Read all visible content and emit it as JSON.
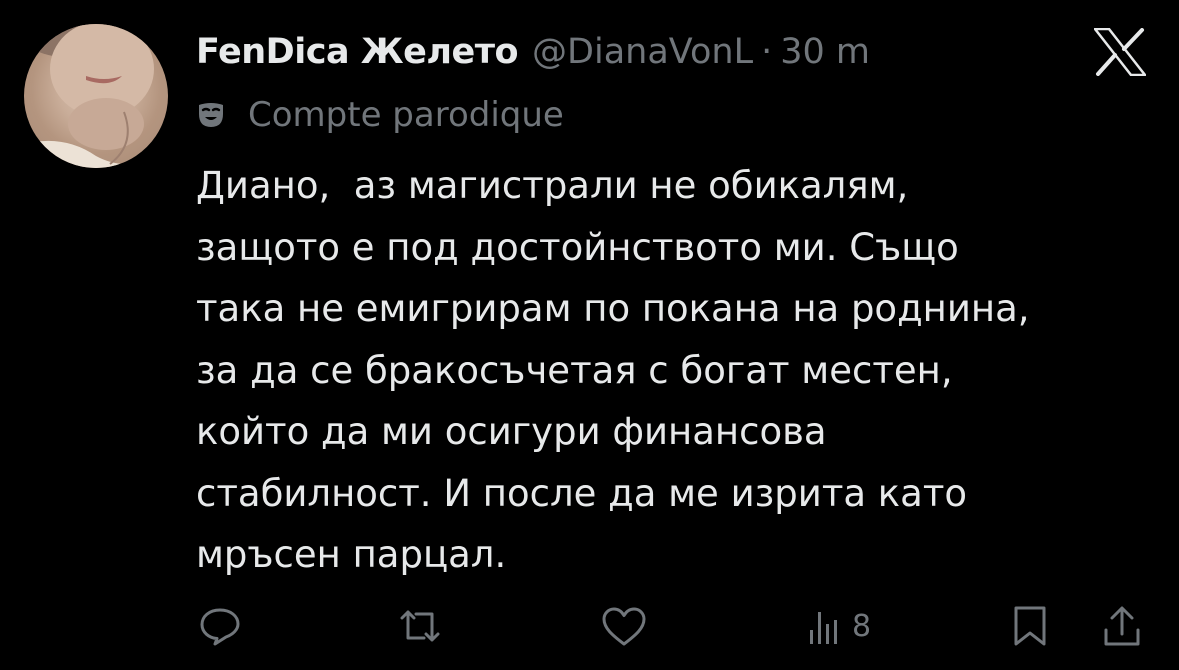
{
  "tweet": {
    "author": {
      "display_name": "FenDica Желето",
      "handle": "@DianaVonL",
      "separator": "·",
      "time": "30 m",
      "label": "Compte parodique"
    },
    "text_lines": [
      "Диано,  аз магистрали не обикалям,",
      "защото е под достойнството ми. Също",
      "така не емигрирам по покана на роднина,",
      "за да се бракосъчетая с богат местен,",
      "който да ми осигури финансова",
      "стабилност. И после да ме изрита като",
      "мръсен парцал."
    ],
    "stats": {
      "views": "8"
    }
  },
  "icons": {
    "brand": "x-logo",
    "label": "parody-mask-icon",
    "actions": [
      "reply-icon",
      "retweet-icon",
      "like-icon",
      "views-icon",
      "bookmark-icon",
      "share-icon"
    ]
  },
  "colors": {
    "background": "#000000",
    "text_primary": "#e7e9ea",
    "text_secondary": "#71767b"
  }
}
